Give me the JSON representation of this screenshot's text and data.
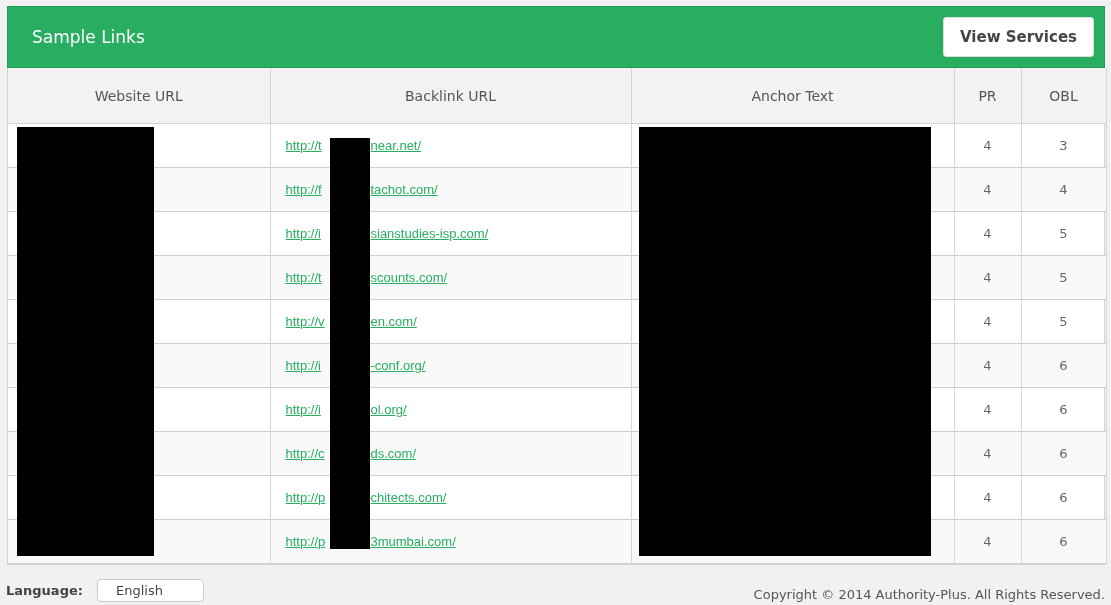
{
  "panel": {
    "title": "Sample Links",
    "button": "View Services"
  },
  "table": {
    "columns": [
      {
        "label": "Website URL",
        "redacted": true
      },
      {
        "label": "Backlink URL",
        "redacted": true
      },
      {
        "label": "Anchor Text",
        "redacted": true
      },
      {
        "label": "PR",
        "redacted": false
      },
      {
        "label": "OBL",
        "redacted": false
      }
    ],
    "rows": [
      {
        "backlink_start": "http://t",
        "backlink_end": "near.net/",
        "pr": "4",
        "obl": "3"
      },
      {
        "backlink_start": "http://f",
        "backlink_end": "tachot.com/",
        "pr": "4",
        "obl": "4"
      },
      {
        "backlink_start": "http://i",
        "backlink_end": "sianstudies-isp.com/",
        "pr": "4",
        "obl": "5"
      },
      {
        "backlink_start": "http://t",
        "backlink_end": "scounts.com/",
        "pr": "4",
        "obl": "5"
      },
      {
        "backlink_start": "http://v",
        "backlink_end": "en.com/",
        "pr": "4",
        "obl": "5"
      },
      {
        "backlink_start": "http://i",
        "backlink_end": "-conf.org/",
        "pr": "4",
        "obl": "6"
      },
      {
        "backlink_start": "http://i",
        "backlink_end": "ol.org/",
        "pr": "4",
        "obl": "6"
      },
      {
        "backlink_start": "http://c",
        "backlink_end": "ds.com/",
        "pr": "4",
        "obl": "6"
      },
      {
        "backlink_start": "http://p",
        "backlink_end": "chitects.com/",
        "pr": "4",
        "obl": "6"
      },
      {
        "backlink_start": "http://p",
        "backlink_end": "3mumbai.com/",
        "pr": "4",
        "obl": "6"
      }
    ]
  },
  "footer": {
    "language_label": "Language:",
    "language_value": "English",
    "copyright": "Copyright © 2014 Authority-Plus. All Rights Reserved."
  }
}
